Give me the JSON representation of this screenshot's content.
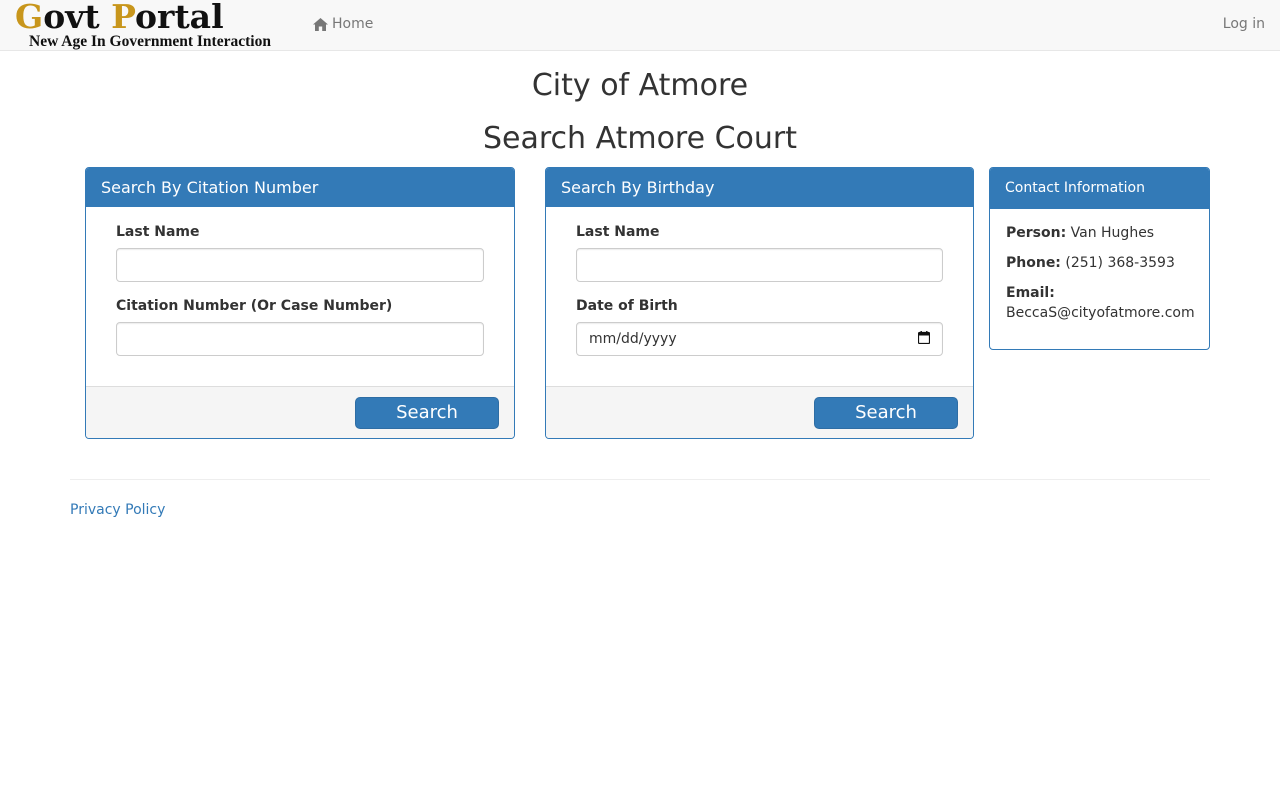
{
  "navbar": {
    "brand_first": "G",
    "brand_mid": "ovt ",
    "brand_second": "P",
    "brand_rest": "ortal",
    "brand_subtitle": "New Age In Government Interaction",
    "home_label": "Home",
    "home_icon": "home-icon",
    "login_label": "Log in"
  },
  "headings": {
    "city": "City of Atmore",
    "search": "Search Atmore Court"
  },
  "citation_panel": {
    "title": "Search By Citation Number",
    "last_name_label": "Last Name",
    "last_name_value": "",
    "citation_label": "Citation Number (Or Case Number)",
    "citation_value": "",
    "search_button": "Search"
  },
  "birthday_panel": {
    "title": "Search By Birthday",
    "last_name_label": "Last Name",
    "last_name_value": "",
    "dob_label": "Date of Birth",
    "dob_placeholder": "mm/dd/yyyy",
    "calendar_icon": "calendar-icon",
    "search_button": "Search"
  },
  "contact_panel": {
    "title": "Contact Information",
    "person_label": "Person:",
    "person_value": "Van Hughes",
    "phone_label": "Phone:",
    "phone_value": "(251) 368-3593",
    "email_label": "Email:",
    "email_value": "BeccaS@cityofatmore.com"
  },
  "footer": {
    "privacy_link": "Privacy Policy"
  },
  "colors": {
    "primary": "#337ab7",
    "brand_gold": "#c8961c",
    "navbar_bg": "#f8f8f8"
  }
}
